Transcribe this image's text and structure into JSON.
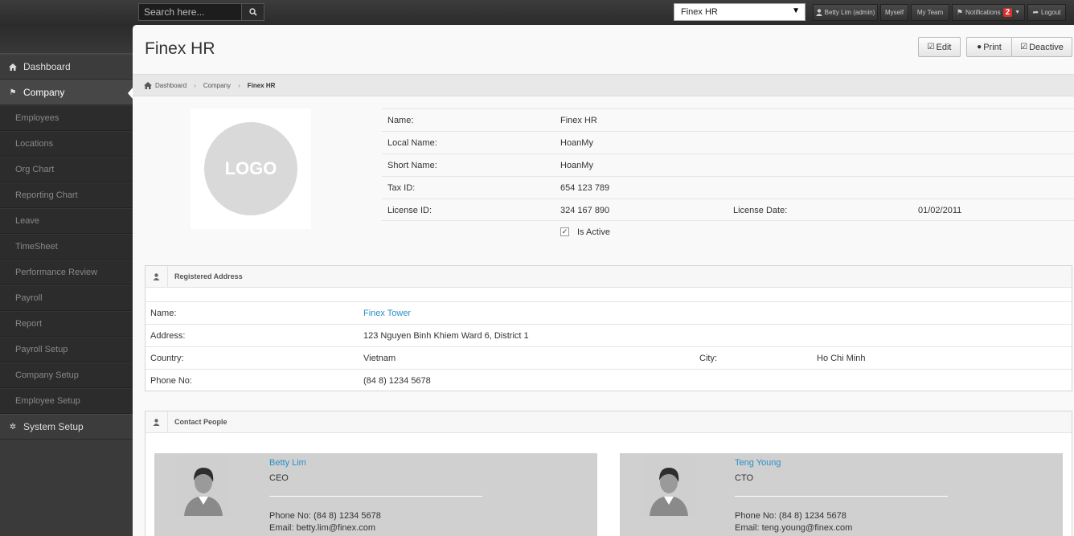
{
  "search": {
    "placeholder": "Search here..."
  },
  "topbar": {
    "company_selected": "Finex HR",
    "user": "Betty Lim (admin)",
    "myself": "Myself",
    "my_team": "My Team",
    "notifications": "Notifications",
    "notification_count": "2",
    "logout": "Logout"
  },
  "sidebar": {
    "dashboard": "Dashboard",
    "company": "Company",
    "sub_items": [
      "Employees",
      "Locations",
      "Org Chart",
      "Reporting Chart",
      "Leave",
      "TimeSheet",
      "Performance Review",
      "Payroll",
      "Report",
      "Payroll Setup",
      "Company Setup",
      "Employee Setup"
    ],
    "system_setup": "System Setup"
  },
  "page": {
    "title": "Finex HR",
    "edit": "Edit",
    "print": "Print",
    "deactive": "Deactive"
  },
  "breadcrumb": {
    "home": "Dashboard",
    "company": "Company",
    "current": "Finex HR"
  },
  "logo_text": "LOGO",
  "info": {
    "name_label": "Name:",
    "name_value": "Finex HR",
    "local_name_label": "Local Name:",
    "local_name_value": "HoanMy",
    "short_name_label": "Short Name:",
    "short_name_value": "HoanMy",
    "tax_label": "Tax ID:",
    "tax_value": "654 123 789",
    "license_label": "License ID:",
    "license_value": "324 167 890",
    "license_date_label": "License Date:",
    "license_date_value": "01/02/2011",
    "is_active_label": "Is Active"
  },
  "address": {
    "heading": "Registered Address",
    "name_label": "Name:",
    "name_value": "Finex Tower",
    "address_label": "Address:",
    "address_value": "123 Nguyen Binh Khiem Ward 6, District 1",
    "country_label": "Country:",
    "country_value": "Vietnam",
    "city_label": "City:",
    "city_value": "Ho Chi Minh",
    "phone_label": "Phone No:",
    "phone_value": "(84 8) 1234 5678"
  },
  "contacts": {
    "heading": "Contact People",
    "people": [
      {
        "name": "Betty Lim",
        "role": "CEO",
        "phone": "Phone No: (84 8) 1234 5678",
        "email": "Email: betty.lim@finex.com"
      },
      {
        "name": "Teng Young",
        "role": "CTO",
        "phone": "Phone No: (84 8) 1234 5678",
        "email": "Email: teng.young@finex.com"
      }
    ]
  }
}
